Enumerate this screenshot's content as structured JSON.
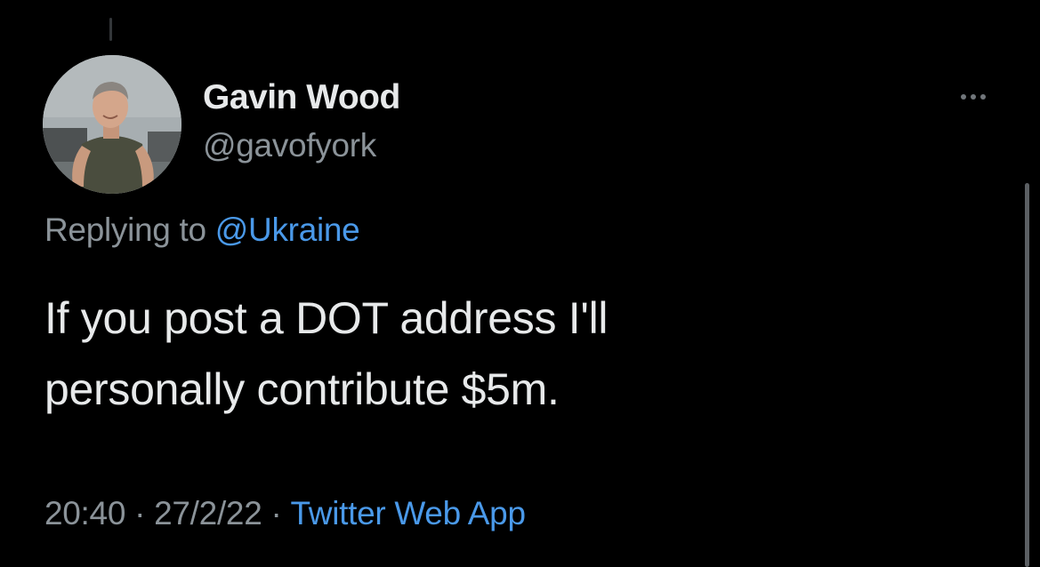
{
  "tweet": {
    "author": {
      "display_name": "Gavin Wood",
      "handle": "@gavofyork",
      "avatar_icon": "profile-photo"
    },
    "replying_prefix": "Replying to",
    "replying_to": "@Ukraine",
    "text_lines": [
      "If you post a DOT address I'll",
      "personally contribute $5m."
    ],
    "time": "20:40",
    "date": "27/2/22",
    "separator": "·",
    "source": "Twitter Web App",
    "more_icon": "more-horizontal-icon"
  },
  "colors": {
    "background": "#000000",
    "primary_text": "#e7e9ea",
    "secondary_text": "#8b9399",
    "link": "#4a99e9"
  }
}
